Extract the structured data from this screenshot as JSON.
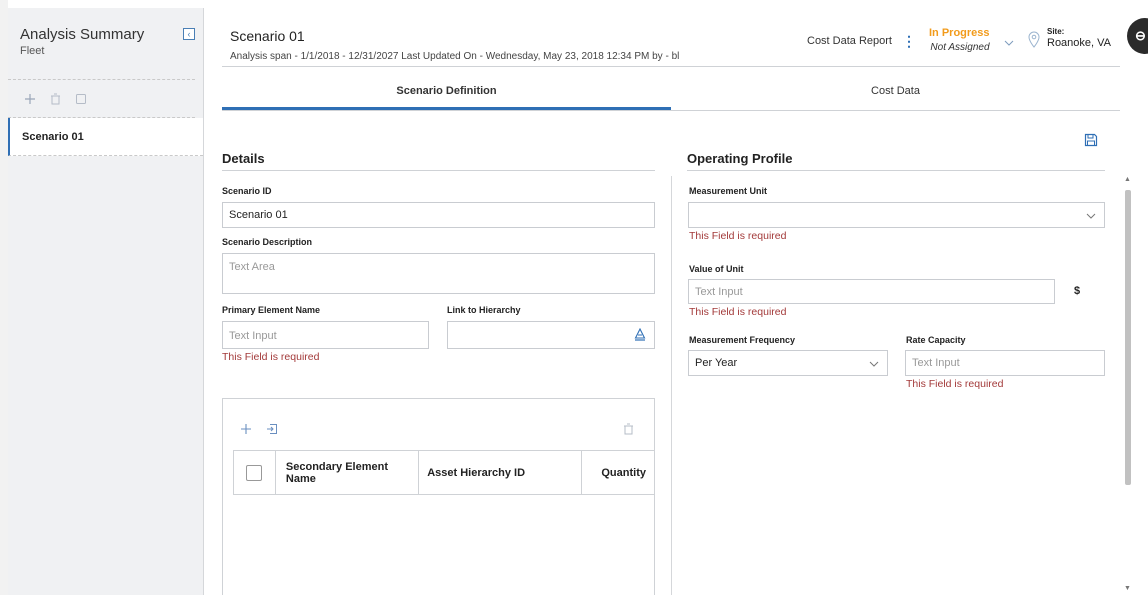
{
  "sidebar": {
    "title": "Analysis Summary",
    "subtitle": "Fleet",
    "items": [
      {
        "label": "Scenario 01"
      }
    ]
  },
  "header": {
    "title": "Scenario 01",
    "subtitle": "Analysis span - 1/1/2018 - 12/31/2027 Last Updated On - Wednesday, May 23, 2018 12:34 PM by - bl",
    "report_label": "Cost Data Report",
    "status": "In Progress",
    "assignment": "Not Assigned",
    "site_label": "Site:",
    "site_value": "Roanoke, VA"
  },
  "tabs": [
    {
      "label": "Scenario Definition",
      "active": true
    },
    {
      "label": "Cost Data",
      "active": false
    }
  ],
  "details": {
    "title": "Details",
    "scenario_id_label": "Scenario ID",
    "scenario_id_value": "Scenario 01",
    "description_label": "Scenario Description",
    "description_placeholder": "Text Area",
    "primary_element_label": "Primary Element Name",
    "primary_element_placeholder": "Text Input",
    "primary_element_error": "This Field is required",
    "link_hierarchy_label": "Link to Hierarchy"
  },
  "secondary_table": {
    "columns": [
      "Secondary Element Name",
      "Asset Hierarchy ID",
      "Quantity"
    ]
  },
  "operating_profile": {
    "title": "Operating Profile",
    "measurement_unit_label": "Measurement Unit",
    "measurement_unit_error": "This Field is required",
    "value_unit_label": "Value of Unit",
    "value_unit_placeholder": "Text Input",
    "value_unit_currency": "$",
    "value_unit_error": "This Field is required",
    "frequency_label": "Measurement Frequency",
    "frequency_value": "Per Year",
    "rate_capacity_label": "Rate Capacity",
    "rate_capacity_placeholder": "Text Input",
    "rate_capacity_error": "This Field is required"
  },
  "colors": {
    "accent": "#2f6fb5",
    "status": "#f29b1b",
    "error": "#a33a3a"
  }
}
